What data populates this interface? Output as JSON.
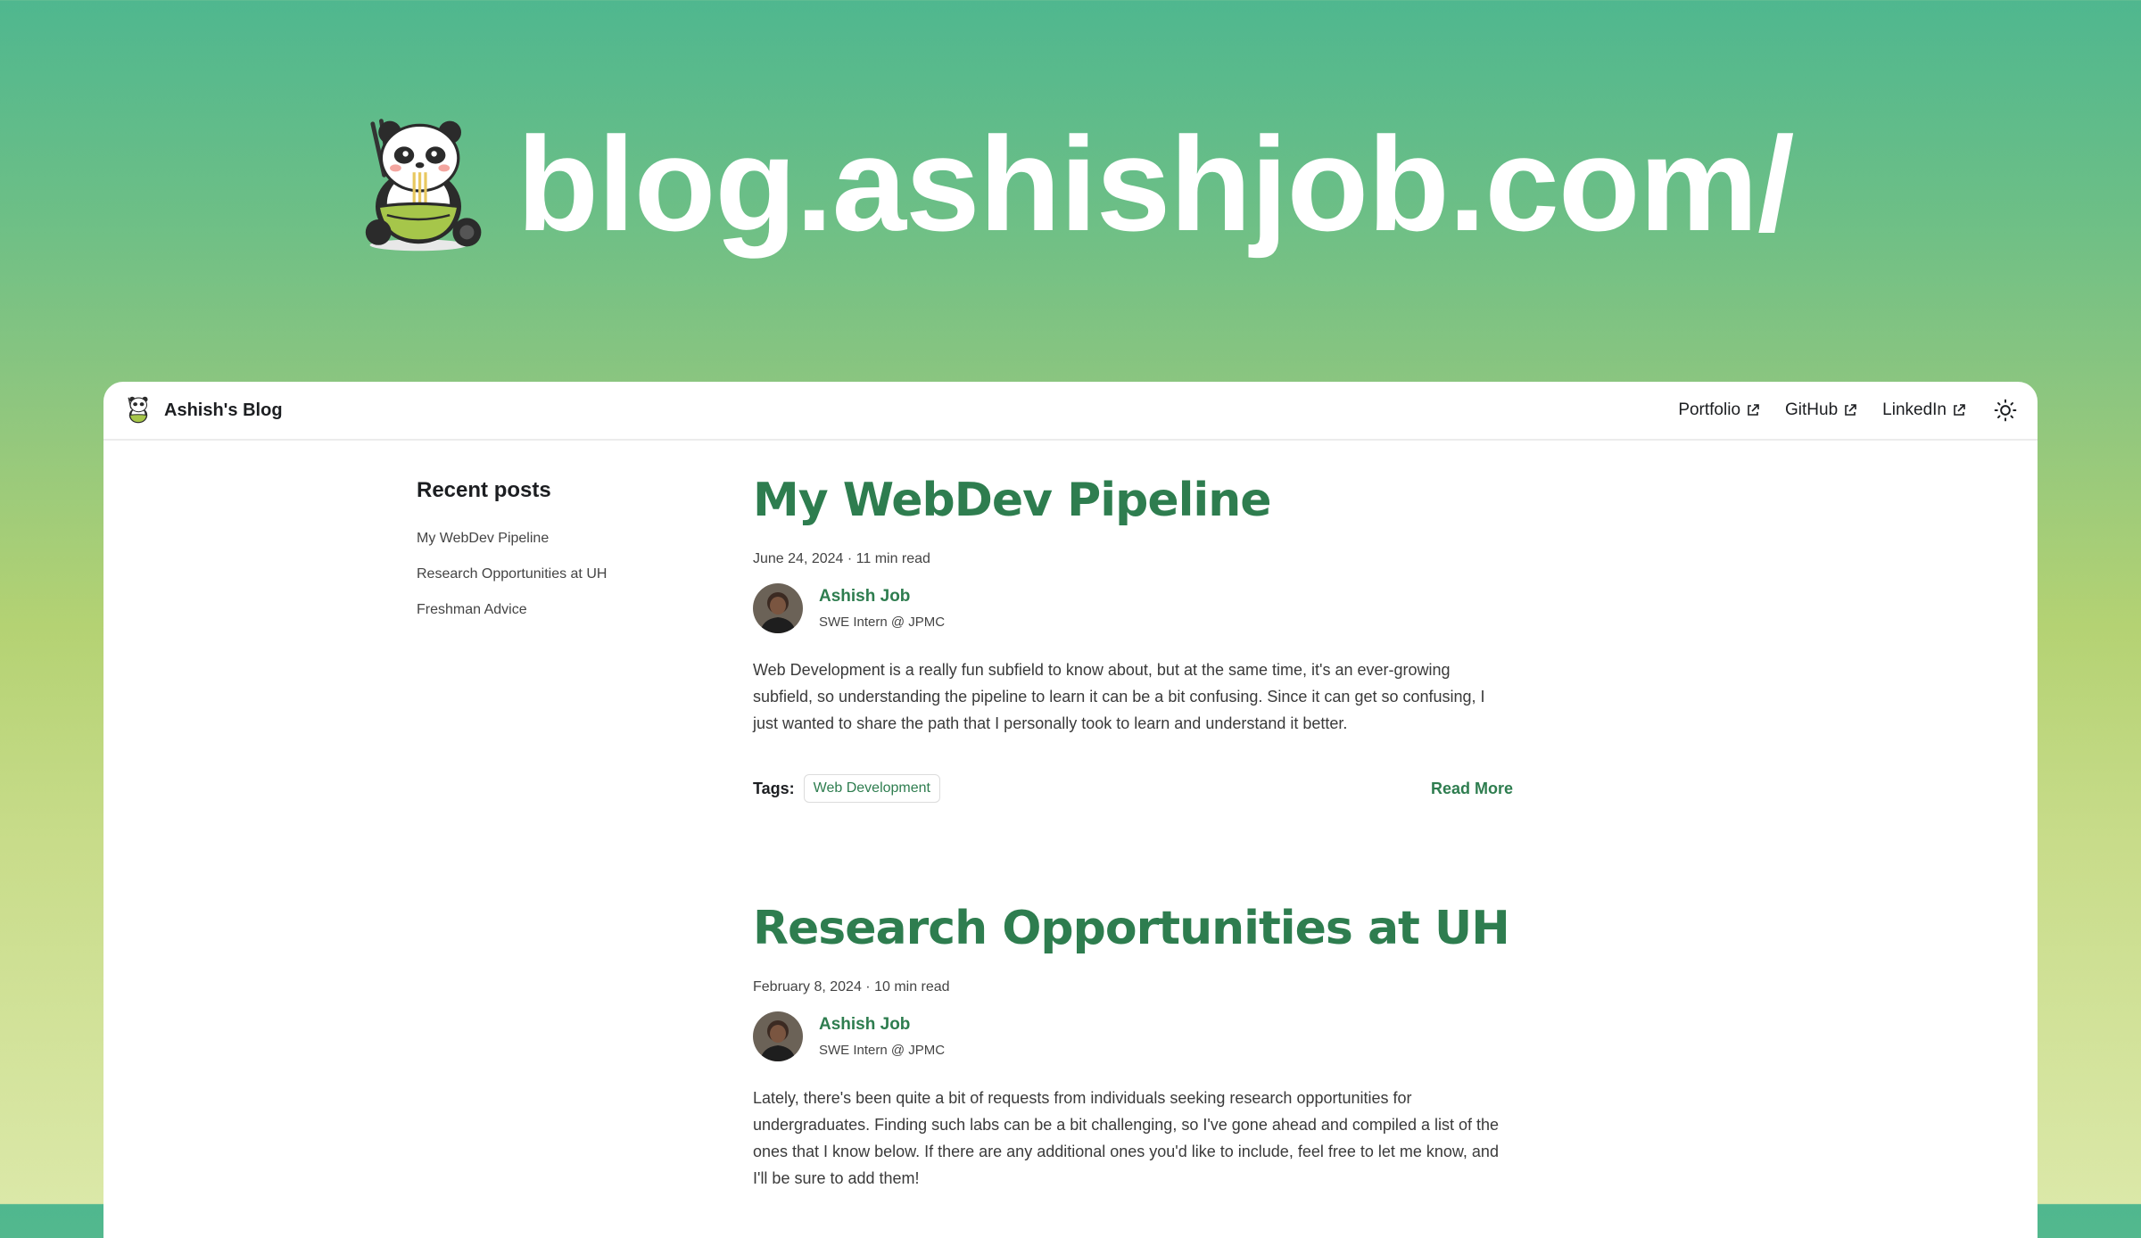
{
  "hero": {
    "title": "blog.ashishjob.com/"
  },
  "navbar": {
    "brand": "Ashish's Blog",
    "links": [
      {
        "label": "Portfolio"
      },
      {
        "label": "GitHub"
      },
      {
        "label": "LinkedIn"
      }
    ],
    "theme_toggle_icon": "sun-icon"
  },
  "sidebar": {
    "title": "Recent posts",
    "items": [
      "My WebDev Pipeline",
      "Research Opportunities at UH",
      "Freshman Advice"
    ]
  },
  "posts": [
    {
      "title": "My WebDev Pipeline",
      "meta": "June 24, 2024 · 11 min read",
      "author": "Ashish Job",
      "role": "SWE Intern @ JPMC",
      "excerpt": "Web Development is a really fun subfield to know about, but at the same time, it's an ever-growing subfield, so understanding the pipeline to learn it can be a bit confusing. Since it can get so confusing, I just wanted to share the path that I personally took to learn and understand it better.",
      "tags_label": "Tags:",
      "tags": [
        "Web Development"
      ],
      "read_more": "Read More"
    },
    {
      "title": "Research Opportunities at UH",
      "meta": "February 8, 2024 · 10 min read",
      "author": "Ashish Job",
      "role": "SWE Intern @ JPMC",
      "excerpt": "Lately, there's been quite a bit of requests from individuals seeking research opportunities for undergraduates. Finding such labs can be a bit challenging, so I've gone ahead and compiled a list of the ones that I know below. If there are any additional ones you'd like to include, feel free to let me know, and I'll be sure to add them!"
    }
  ],
  "colors": {
    "accent": "#2e7d4f",
    "text": "#1c1e21"
  }
}
